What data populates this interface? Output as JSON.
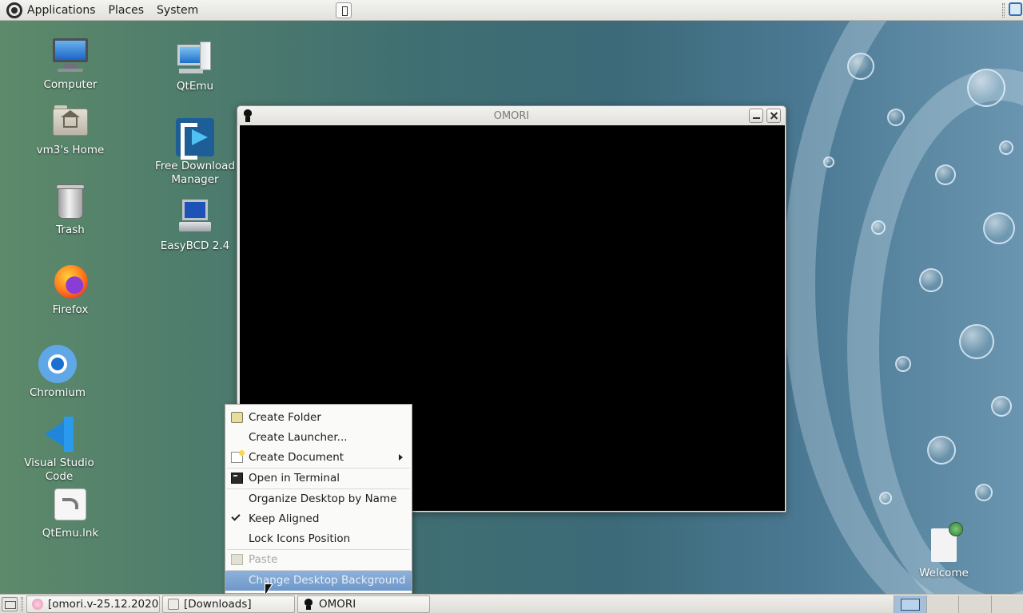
{
  "top_panel": {
    "menus": [
      "Applications",
      "Places",
      "System"
    ]
  },
  "desktop_icons": {
    "computer": "Computer",
    "home": "vm3's Home",
    "trash": "Trash",
    "firefox": "Firefox",
    "chromium": "Chromium",
    "vscode": "Visual Studio Code",
    "qtemu_lnk": "QtEmu.lnk",
    "qtemu": "QtEmu",
    "fdm": "Free Download Manager",
    "easybcd": "EasyBCD 2.4",
    "welcome": "Welcome"
  },
  "window": {
    "title": "OMORI"
  },
  "context_menu": {
    "items": [
      {
        "label": "Create Folder"
      },
      {
        "label": "Create Launcher..."
      },
      {
        "label": "Create Document"
      },
      {
        "label": "Open in Terminal"
      },
      {
        "label": "Organize Desktop by Name"
      },
      {
        "label": "Keep Aligned"
      },
      {
        "label": "Lock Icons Position"
      },
      {
        "label": "Paste"
      },
      {
        "label": "Change Desktop Background"
      }
    ]
  },
  "taskbar": {
    "tasks": [
      {
        "label": "[omori.v-25.12.2020..."
      },
      {
        "label": "[Downloads]"
      },
      {
        "label": "OMORI"
      }
    ]
  }
}
